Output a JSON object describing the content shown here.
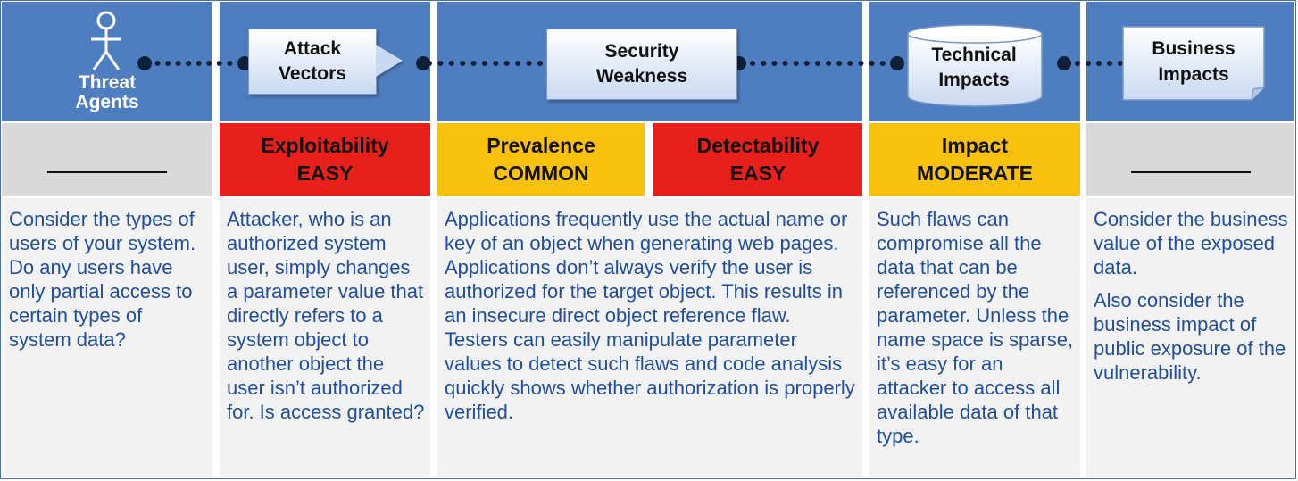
{
  "threat_agents": {
    "label_line1": "Threat",
    "label_line2": "Agents",
    "rating_blank": "",
    "description": "Consider the types of users of your system. Do any users have only partial access to certain types of system data?"
  },
  "attack_vectors": {
    "label_line1": "Attack",
    "label_line2": "Vectors",
    "rating_label": "Exploitability",
    "rating_value": "EASY",
    "rating_color": "#e8201b",
    "description": "Attacker, who is an authorized system user, simply changes a parameter value that directly refers to a system object to another object the user isn’t authorized for. Is access granted?"
  },
  "security_weakness": {
    "label_line1": "Security",
    "label_line2": "Weakness",
    "prevalence_label": "Prevalence",
    "prevalence_value": "COMMON",
    "prevalence_color": "#f7c10d",
    "detectability_label": "Detectability",
    "detectability_value": "EASY",
    "detectability_color": "#e8201b",
    "description": "Applications frequently use the actual name or key of an object when generating web pages. Applications don’t always verify the user is authorized for the target object. This results in an insecure direct object reference flaw. Testers can easily manipulate parameter values to detect such flaws and code analysis quickly shows whether authorization is properly verified."
  },
  "technical_impacts": {
    "label_line1": "Technical",
    "label_line2": "Impacts",
    "rating_label": "Impact",
    "rating_value": "MODERATE",
    "rating_color": "#f7c10d",
    "description": "Such flaws can compromise all the data that can be referenced by the parameter. Unless the name space is sparse, it’s easy for an attacker to access all available data of that type."
  },
  "business_impacts": {
    "label_line1": "Business",
    "label_line2": "Impacts",
    "description_p1": "Consider the business value of the exposed data.",
    "description_p2": "Also consider the business impact of public exposure of the vulnerability."
  },
  "colors": {
    "header_blue": "#4f7ec0",
    "description_text": "#1f4e9c"
  },
  "icons": [
    "stick-figure-icon",
    "arrow-right-icon",
    "cylinder-icon",
    "document-icon"
  ]
}
